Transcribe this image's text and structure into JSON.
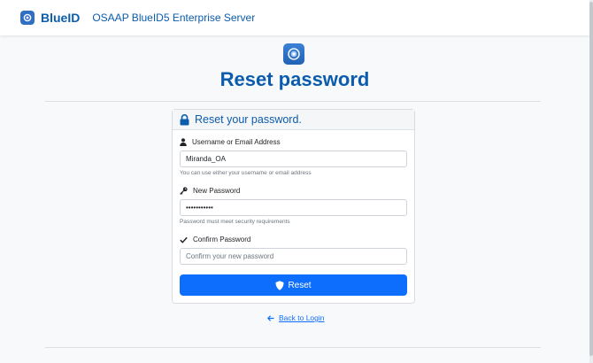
{
  "navbar": {
    "brand": "BlueID",
    "subtitle": "OSAAP BlueID5 Enterprise Server",
    "logo_icon": "blueid-logo-icon"
  },
  "page": {
    "title": "Reset password",
    "logo_icon": "blueid-logo-icon"
  },
  "card": {
    "title": "Reset your password.",
    "title_icon": "lock-icon"
  },
  "fields": {
    "username": {
      "label": "Username or Email Address",
      "icon": "user-icon",
      "value": "Miranda_OA",
      "help": "You can use either your username or email address"
    },
    "new_password": {
      "label": "New Password",
      "icon": "key-icon",
      "value": "•••••••••••",
      "help": "Password must meet security requirements"
    },
    "confirm_password": {
      "label": "Confirm Password",
      "icon": "check-icon",
      "value": "",
      "placeholder": "Confirm your new password"
    }
  },
  "reset_button": {
    "label": "Reset",
    "icon": "shield-icon"
  },
  "back_link": {
    "label": "Back to Login",
    "icon": "arrow-left-icon"
  },
  "colors": {
    "brand": "#0b5cad",
    "primary": "#0d6efd",
    "muted": "#6c757d",
    "background": "#f8f9fa"
  }
}
